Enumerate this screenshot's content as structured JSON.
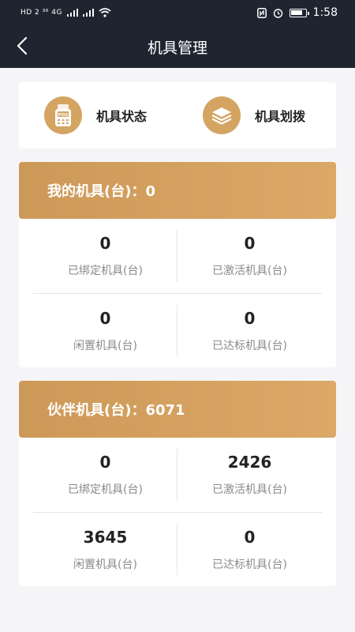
{
  "status_bar": {
    "network": "HD 2 ³⁶ 4G",
    "time": "1:58",
    "battery_level": 0.8
  },
  "nav": {
    "title": "机具管理"
  },
  "menu": [
    {
      "label": "机具状态",
      "icon": "pos-machine-icon"
    },
    {
      "label": "机具划拨",
      "icon": "stack-layers-icon"
    }
  ],
  "my_devices": {
    "title": "我的机具(台)：0",
    "stats": [
      {
        "value": "0",
        "label": "已绑定机具(台)"
      },
      {
        "value": "0",
        "label": "已激活机具(台)"
      },
      {
        "value": "0",
        "label": "闲置机具(台)"
      },
      {
        "value": "0",
        "label": "已达标机具(台)"
      }
    ]
  },
  "partner_devices": {
    "title": "伙伴机具(台)：6071",
    "stats": [
      {
        "value": "0",
        "label": "已绑定机具(台)"
      },
      {
        "value": "2426",
        "label": "已激活机具(台)"
      },
      {
        "value": "3645",
        "label": "闲置机具(台)"
      },
      {
        "value": "0",
        "label": "已达标机具(台)"
      }
    ]
  },
  "colors": {
    "header_bg": "#1f2530",
    "accent": "#d4a462",
    "page_bg": "#f5f5f7"
  }
}
